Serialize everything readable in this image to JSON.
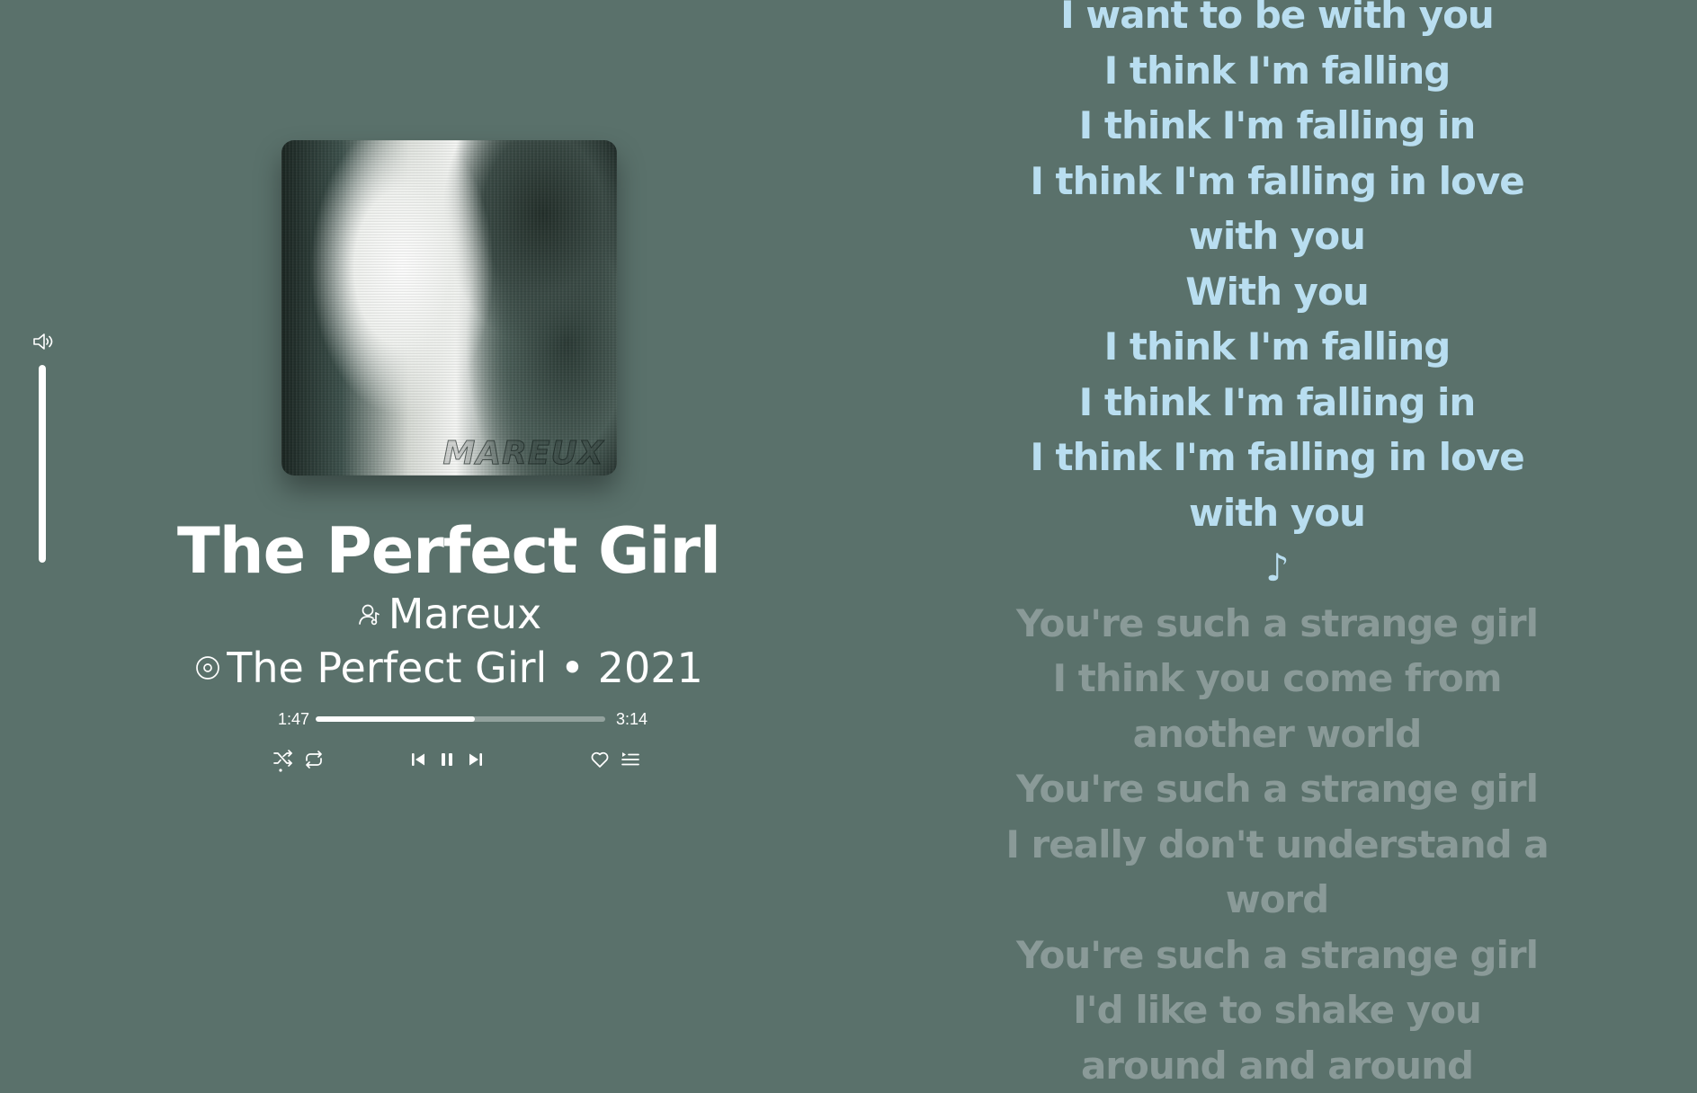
{
  "colors": {
    "background": "#5a716b",
    "lyric_sung": "#b9def0",
    "lyric_upcoming": "#8a9a98",
    "text": "#ffffff"
  },
  "volume": {
    "icon": "speaker-icon",
    "level": 1.0
  },
  "album_art": {
    "logo_text": "MAREUX"
  },
  "track": {
    "title": "The Perfect Girl",
    "artist": "Mareux",
    "artist_icon": "artist-icon",
    "album_line": "The Perfect Girl • 2021",
    "album_icon": "album-disc-icon"
  },
  "progress": {
    "elapsed": "1:47",
    "total": "3:14",
    "fraction": 0.551
  },
  "controls": {
    "shuffle_icon": "shuffle-icon",
    "repeat_icon": "repeat-icon",
    "previous_icon": "skip-previous-icon",
    "pause_icon": "pause-icon",
    "next_icon": "skip-next-icon",
    "like_icon": "heart-icon",
    "queue_icon": "queue-icon"
  },
  "lyrics": [
    {
      "text": "I want to be with you",
      "state": "sung"
    },
    {
      "text": "I think I'm falling",
      "state": "sung"
    },
    {
      "text": "I think I'm falling in",
      "state": "sung"
    },
    {
      "text": "I think I'm falling in love with you",
      "state": "sung"
    },
    {
      "text": "With you",
      "state": "sung"
    },
    {
      "text": "I think I'm falling",
      "state": "sung"
    },
    {
      "text": "I think I'm falling in",
      "state": "sung"
    },
    {
      "text": "I think I'm falling in love with you",
      "state": "sung"
    },
    {
      "text": "♪",
      "state": "sung"
    },
    {
      "text": "You're such a strange girl",
      "state": "upcoming"
    },
    {
      "text": "I think you come from another world",
      "state": "upcoming"
    },
    {
      "text": "You're such a strange girl",
      "state": "upcoming"
    },
    {
      "text": "I really don't understand a word",
      "state": "upcoming"
    },
    {
      "text": "You're such a strange girl",
      "state": "upcoming"
    },
    {
      "text": "I'd like to shake you around and around",
      "state": "upcoming"
    }
  ]
}
